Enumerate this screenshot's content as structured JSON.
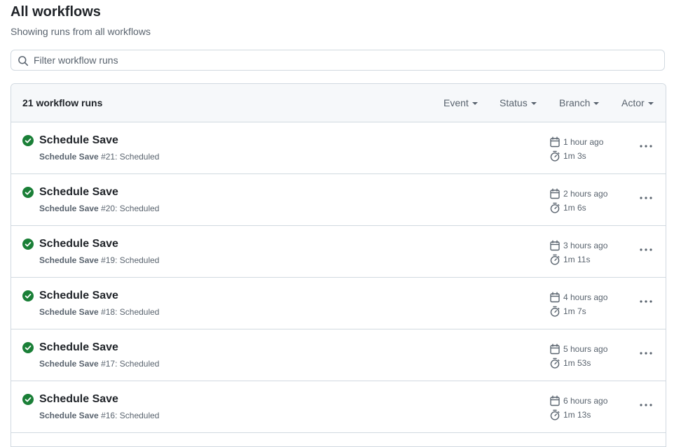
{
  "header": {
    "title": "All workflows",
    "subtitle": "Showing runs from all workflows"
  },
  "search": {
    "placeholder": "Filter workflow runs",
    "value": ""
  },
  "list": {
    "count_label": "21 workflow runs",
    "filters": {
      "event": "Event",
      "status": "Status",
      "branch": "Branch",
      "actor": "Actor"
    },
    "runs": [
      {
        "title": "Schedule Save",
        "workflow": "Schedule Save",
        "number": "#21",
        "trigger": ": Scheduled",
        "date": "1 hour ago",
        "duration": "1m 3s"
      },
      {
        "title": "Schedule Save",
        "workflow": "Schedule Save",
        "number": "#20",
        "trigger": ": Scheduled",
        "date": "2 hours ago",
        "duration": "1m 6s"
      },
      {
        "title": "Schedule Save",
        "workflow": "Schedule Save",
        "number": "#19",
        "trigger": ": Scheduled",
        "date": "3 hours ago",
        "duration": "1m 11s"
      },
      {
        "title": "Schedule Save",
        "workflow": "Schedule Save",
        "number": "#18",
        "trigger": ": Scheduled",
        "date": "4 hours ago",
        "duration": "1m 7s"
      },
      {
        "title": "Schedule Save",
        "workflow": "Schedule Save",
        "number": "#17",
        "trigger": ": Scheduled",
        "date": "5 hours ago",
        "duration": "1m 53s"
      },
      {
        "title": "Schedule Save",
        "workflow": "Schedule Save",
        "number": "#16",
        "trigger": ": Scheduled",
        "date": "6 hours ago",
        "duration": "1m 13s"
      }
    ]
  },
  "icons": {
    "status": "check-circle-fill-icon",
    "date": "calendar-icon",
    "duration": "stopwatch-icon",
    "more": "kebab-horizontal-icon",
    "search": "search-icon"
  },
  "colors": {
    "success": "#1a7f37",
    "muted": "#59636e",
    "border": "#d1d9e0",
    "header_bg": "#f6f8fa"
  }
}
